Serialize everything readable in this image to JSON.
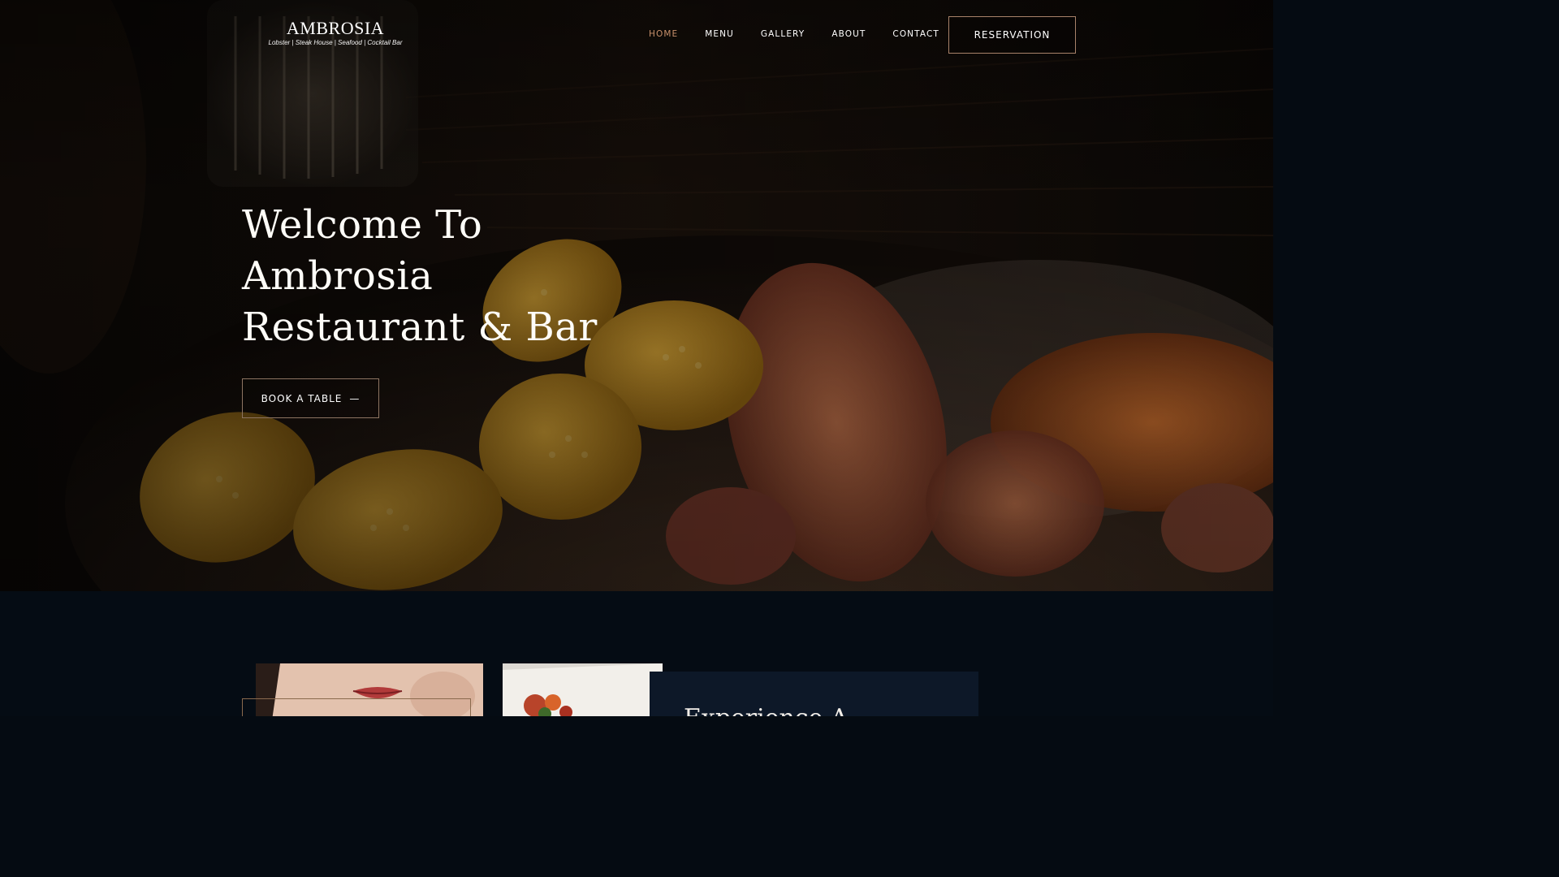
{
  "brand": {
    "name": "AMBROSIA",
    "tagline": "Lobster | Steak House | Seafood | Cocktail Bar"
  },
  "nav": {
    "items": [
      {
        "label": "HOME",
        "active": true
      },
      {
        "label": "MENU",
        "active": false
      },
      {
        "label": "GALLERY",
        "active": false
      },
      {
        "label": "ABOUT",
        "active": false
      },
      {
        "label": "CONTACT",
        "active": false
      }
    ],
    "reservation_label": "RESERVATION"
  },
  "hero": {
    "title_lines": [
      "Welcome To",
      "Ambrosia",
      "Restaurant & Bar"
    ],
    "cta_label": "BOOK A TABLE",
    "cta_icon": "long-dash-icon"
  },
  "about": {
    "card_title": "Experience A"
  },
  "colors": {
    "accent": "#c8906b",
    "button_border": "#a8826a",
    "section_bg": "#050c14",
    "card_bg": "#0d1828"
  }
}
